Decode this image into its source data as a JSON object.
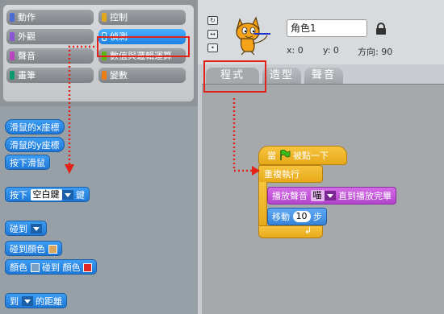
{
  "categories": [
    {
      "label": "動作",
      "color": "#4a6cd4",
      "selected": false
    },
    {
      "label": "控制",
      "color": "#e1a91a",
      "selected": false
    },
    {
      "label": "外觀",
      "color": "#8a55d7",
      "selected": false
    },
    {
      "label": "偵測",
      "color": "#2ca5e2",
      "selected": true
    },
    {
      "label": "聲音",
      "color": "#bb42c3",
      "selected": false
    },
    {
      "label": "數值與邏輯運算",
      "color": "#5cb712",
      "selected": false
    },
    {
      "label": "畫筆",
      "color": "#0e9a6c",
      "selected": false
    },
    {
      "label": "變數",
      "color": "#ee7d16",
      "selected": false
    }
  ],
  "palette": {
    "mouse_x": "滑鼠的x座標",
    "mouse_y": "滑鼠的y座標",
    "mouse_down": "按下滑鼠",
    "key_pressed_prefix": "按下",
    "key_pressed_key": "空白鍵",
    "key_pressed_suffix": "鍵",
    "touching": "碰到",
    "touching_color": "碰到顏色",
    "color_prefix": "顏色",
    "color_touching": "碰到 顏色",
    "distance_prefix": "到",
    "distance_suffix": "的距離"
  },
  "sprite": {
    "name": "角色1",
    "x_label": "x: 0",
    "y_label": "y: 0",
    "direction_label": "方向: 90"
  },
  "tabs": [
    {
      "label": "程式",
      "active": true
    },
    {
      "label": "造型",
      "active": false
    },
    {
      "label": "聲音",
      "active": false
    }
  ],
  "script": {
    "hat_prefix": "當",
    "hat_suffix": "被點一下",
    "forever": "重複執行",
    "play_sound_prefix": "播放聲音",
    "play_sound_value": "喵",
    "play_sound_suffix": "直到播放完畢",
    "move_prefix": "移動",
    "move_value": "10",
    "move_suffix": "步"
  },
  "colors": {
    "sensing": "#2ca5e2",
    "control": "#e8a91a",
    "sound": "#b245cc",
    "motion": "#3884da",
    "highlight": "#e2231a"
  }
}
